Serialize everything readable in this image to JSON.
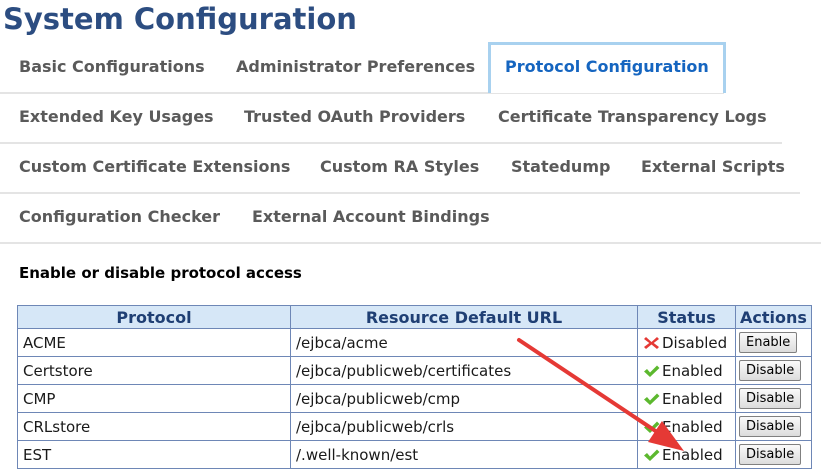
{
  "page": {
    "title": "System Configuration"
  },
  "tabs": {
    "row1": [
      {
        "label": "Basic Configurations"
      },
      {
        "label": "Administrator Preferences"
      },
      {
        "label": "Protocol Configuration",
        "active": true
      }
    ],
    "row2": [
      {
        "label": "Extended Key Usages"
      },
      {
        "label": "Trusted OAuth Providers"
      },
      {
        "label": "Certificate Transparency Logs"
      }
    ],
    "row3": [
      {
        "label": "Custom Certificate Extensions"
      },
      {
        "label": "Custom RA Styles"
      },
      {
        "label": "Statedump"
      },
      {
        "label": "External Scripts"
      }
    ],
    "row4": [
      {
        "label": "Configuration Checker"
      },
      {
        "label": "External Account Bindings"
      }
    ]
  },
  "section": {
    "heading": "Enable or disable protocol access"
  },
  "table": {
    "headers": [
      "Protocol",
      "Resource Default URL",
      "Status",
      "Actions"
    ],
    "rows": [
      {
        "protocol": "ACME",
        "url": "/ejbca/acme",
        "status": "Disabled",
        "status_icon": "red-x-icon",
        "action": "Enable"
      },
      {
        "protocol": "Certstore",
        "url": "/ejbca/publicweb/certificates",
        "status": "Enabled",
        "status_icon": "green-check-icon",
        "action": "Disable"
      },
      {
        "protocol": "CMP",
        "url": "/ejbca/publicweb/cmp",
        "status": "Enabled",
        "status_icon": "green-check-icon",
        "action": "Disable"
      },
      {
        "protocol": "CRLstore",
        "url": "/ejbca/publicweb/crls",
        "status": "Enabled",
        "status_icon": "green-check-icon",
        "action": "Disable"
      },
      {
        "protocol": "EST",
        "url": "/.well-known/est",
        "status": "Enabled",
        "status_icon": "green-check-icon",
        "action": "Disable"
      }
    ]
  },
  "colors": {
    "title": "#2c4d81",
    "active_tab_text": "#1565c0",
    "active_tab_border": "#a8d1ef",
    "table_header_bg": "#d6e7f7",
    "table_border": "#6e87b6",
    "annotation_arrow": "#e53935"
  }
}
